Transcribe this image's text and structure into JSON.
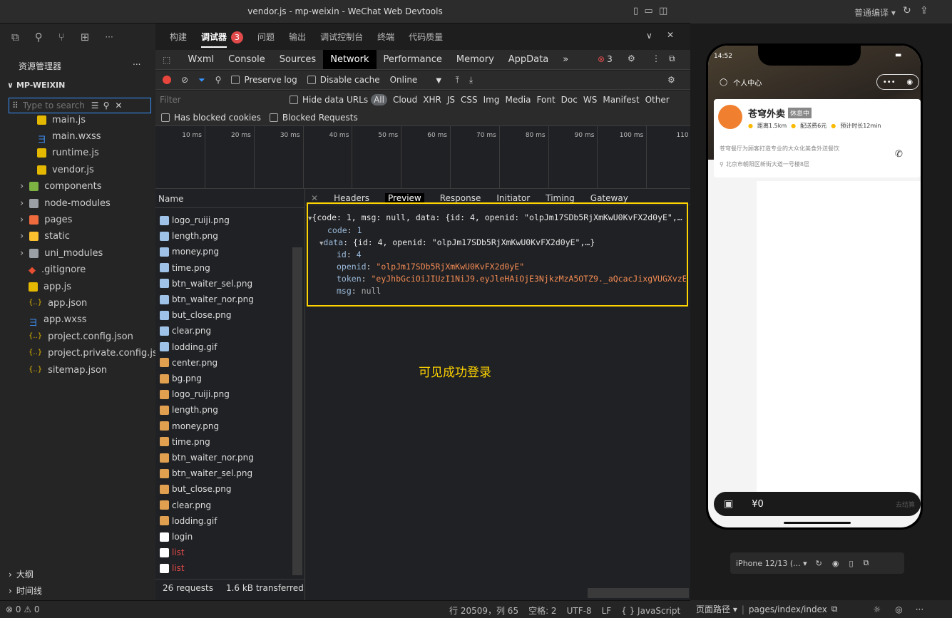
{
  "window": {
    "title": "vendor.js - mp-weixin - WeChat Web Devtools"
  },
  "right_title": {
    "compile_mode": "普通编译 ▾"
  },
  "explorer": {
    "title": "资源管理器",
    "more": "...",
    "project": "MP-WEIXIN",
    "search_placeholder": "Type to search",
    "files": [
      {
        "name": "main.js",
        "type": "js"
      },
      {
        "name": "main.wxss",
        "type": "css"
      },
      {
        "name": "runtime.js",
        "type": "js"
      },
      {
        "name": "vendor.js",
        "type": "js"
      },
      {
        "name": "components",
        "type": "folder"
      },
      {
        "name": "node-modules",
        "type": "folder"
      },
      {
        "name": "pages",
        "type": "folder"
      },
      {
        "name": "static",
        "type": "folder"
      },
      {
        "name": "uni_modules",
        "type": "folder"
      },
      {
        "name": ".gitignore",
        "type": "git"
      },
      {
        "name": "app.js",
        "type": "js"
      },
      {
        "name": "app.json",
        "type": "json"
      },
      {
        "name": "app.wxss",
        "type": "css"
      },
      {
        "name": "project.config.json",
        "type": "json"
      },
      {
        "name": "project.private.config.js...",
        "type": "json"
      },
      {
        "name": "sitemap.json",
        "type": "json"
      }
    ],
    "outline": "大纲",
    "timeline": "时间线"
  },
  "devtools_header": {
    "tabs": [
      "构建",
      "调试器",
      "问题",
      "输出",
      "调试控制台",
      "终端",
      "代码质量"
    ],
    "active": "调试器",
    "badge": "3"
  },
  "devtools_tabs": {
    "items": [
      "Wxml",
      "Console",
      "Sources",
      "Network",
      "Performance",
      "Memory",
      "AppData",
      "»"
    ],
    "active": "Network",
    "error_count": "3"
  },
  "network_controls": {
    "preserve_log": "Preserve log",
    "disable_cache": "Disable cache",
    "throttle": "Online"
  },
  "filter": {
    "placeholder": "Filter",
    "hide_data_urls": "Hide data URLs",
    "types": [
      "All",
      "Cloud",
      "XHR",
      "JS",
      "CSS",
      "Img",
      "Media",
      "Font",
      "Doc",
      "WS",
      "Manifest",
      "Other"
    ],
    "has_blocked_cookies": "Has blocked cookies",
    "blocked_requests": "Blocked Requests"
  },
  "timeline": {
    "ticks": [
      "10 ms",
      "20 ms",
      "30 ms",
      "40 ms",
      "50 ms",
      "60 ms",
      "70 ms",
      "80 ms",
      "90 ms",
      "100 ms",
      "110 ı"
    ]
  },
  "requests": {
    "header": "Name",
    "items": [
      {
        "name": "logo_ruiji.png",
        "color": "#ddd"
      },
      {
        "name": "length.png",
        "color": "#ddd"
      },
      {
        "name": "money.png",
        "color": "#ddd"
      },
      {
        "name": "time.png",
        "color": "#ddd"
      },
      {
        "name": "btn_waiter_sel.png",
        "color": "#ddd"
      },
      {
        "name": "btn_waiter_nor.png",
        "color": "#ddd"
      },
      {
        "name": "but_close.png",
        "color": "#ddd"
      },
      {
        "name": "clear.png",
        "color": "#ddd"
      },
      {
        "name": "lodding.gif",
        "color": "#ddd"
      },
      {
        "name": "center.png",
        "color": "#ddd"
      },
      {
        "name": "bg.png",
        "color": "#ddd"
      },
      {
        "name": "logo_ruiji.png",
        "color": "#ddd"
      },
      {
        "name": "length.png",
        "color": "#ddd"
      },
      {
        "name": "money.png",
        "color": "#ddd"
      },
      {
        "name": "time.png",
        "color": "#ddd"
      },
      {
        "name": "btn_waiter_nor.png",
        "color": "#ddd"
      },
      {
        "name": "btn_waiter_sel.png",
        "color": "#ddd"
      },
      {
        "name": "but_close.png",
        "color": "#ddd"
      },
      {
        "name": "clear.png",
        "color": "#ddd"
      },
      {
        "name": "lodding.gif",
        "color": "#ddd"
      },
      {
        "name": "login",
        "color": "#ddd"
      },
      {
        "name": "list",
        "color": "#e04a4a"
      },
      {
        "name": "list",
        "color": "#e04a4a"
      }
    ],
    "summary_requests": "26 requests",
    "summary_transferred": "1.6 kB transferred"
  },
  "detail_tabs": {
    "items": [
      "Headers",
      "Preview",
      "Response",
      "Initiator",
      "Timing",
      "Gateway"
    ],
    "active": "Preview"
  },
  "preview": {
    "line1": "{code: 1, msg: null, data: {id: 4, openid: \"olpJm17SDb5RjXmKwU0KvFX2d0yE\",…",
    "code_key": "code",
    "code_val": "1",
    "data_key": "data",
    "data_summary": "{id: 4, openid: \"olpJm17SDb5RjXmKwU0KvFX2d0yE\",…}",
    "id_key": "id",
    "id_val": "4",
    "openid_key": "openid",
    "openid_val": "\"olpJm17SDb5RjXmKwU0KvFX2d0yE\"",
    "token_key": "token",
    "token_val": "\"eyJhbGciOiJIUzI1NiJ9.eyJleHAiOjE3NjkzMzA5OTZ9._aQcacJixgVUGXvzE",
    "msg_key": "msg",
    "msg_val": "null"
  },
  "annotation": "可见成功登录",
  "statusbar": {
    "errors": "⊗ 0 ⚠ 0",
    "cursor": "行 20509，列 65",
    "spaces": "空格: 2",
    "encoding": "UTF-8",
    "eol": "LF",
    "language": "{ } JavaScript"
  },
  "right_status": {
    "path_label": "页面路径 ▾",
    "path": "pages/index/index"
  },
  "phone": {
    "time": "14:52",
    "nav_title": "个人中心",
    "shop_name": "苍穹外卖",
    "shop_status": "休息中",
    "distance": "距离1.5km",
    "fee": "配送费6元",
    "eta": "预计时长12min",
    "desc": "苍穹餐厅为顾客打造专业的大众化美食外送餐饮",
    "address": "北京市朝阳区新街大道一号楼8层",
    "cart_price": "¥0",
    "checkout": "去结算",
    "device": "iPhone 12/13 (... ▾"
  },
  "colors": {
    "accent_yellow": "#ffd400",
    "active_tab_bg": "#000000",
    "error_red": "#e04a4a",
    "link_blue": "#3794ff"
  }
}
